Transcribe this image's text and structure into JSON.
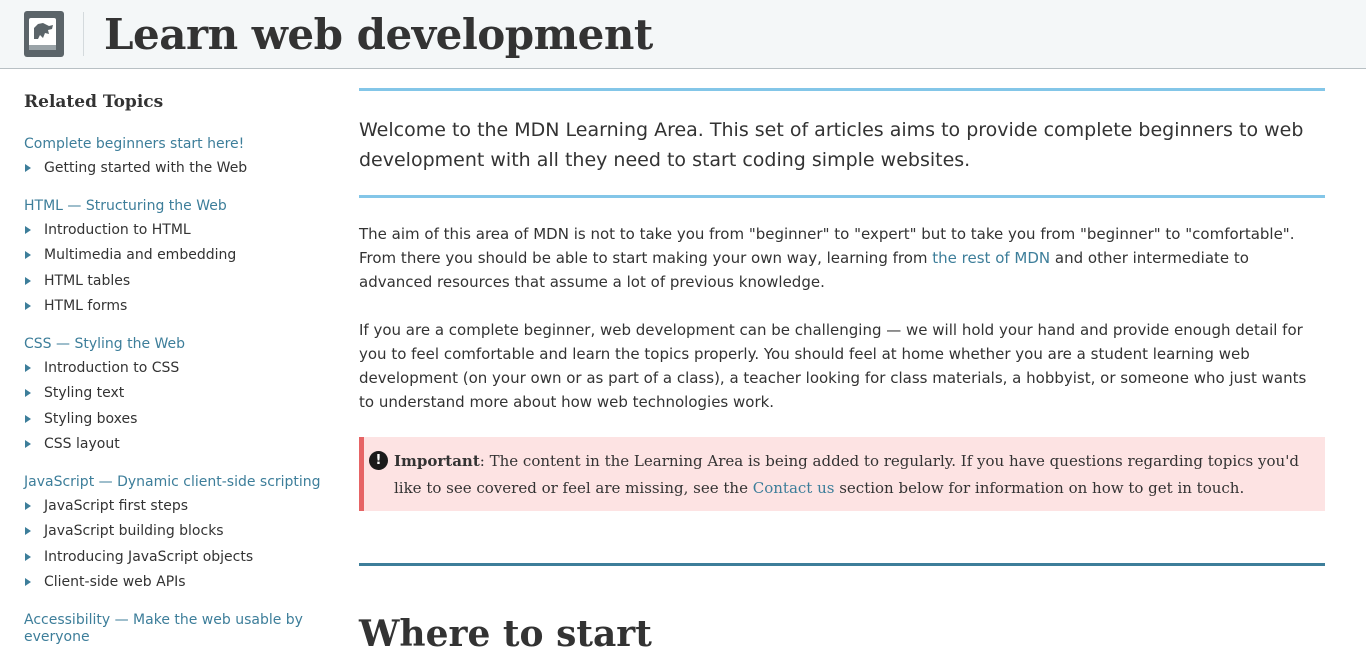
{
  "header": {
    "title": "Learn web development"
  },
  "sidebar": {
    "heading": "Related Topics",
    "groups": [
      {
        "title": "Complete beginners start here!",
        "items": [
          "Getting started with the Web"
        ]
      },
      {
        "title": "HTML — Structuring the Web",
        "items": [
          "Introduction to HTML",
          "Multimedia and embedding",
          "HTML tables",
          "HTML forms"
        ]
      },
      {
        "title": "CSS — Styling the Web",
        "items": [
          "Introduction to CSS",
          "Styling text",
          "Styling boxes",
          "CSS layout"
        ]
      },
      {
        "title": "JavaScript — Dynamic client-side scripting",
        "items": [
          "JavaScript first steps",
          "JavaScript building blocks",
          "Introducing JavaScript objects",
          "Client-side web APIs"
        ]
      },
      {
        "title": "Accessibility — Make the web usable by everyone",
        "items": []
      }
    ]
  },
  "main": {
    "intro": "Welcome to the MDN Learning Area. This set of articles aims to provide complete beginners to web development with all they need to start coding simple websites.",
    "para1_before": "The aim of this area of MDN is not to take you from \"beginner\" to \"expert\" but to take you from \"beginner\" to \"comfortable\". From there you should be able to start making your own way, learning from ",
    "para1_link": "the rest of MDN",
    "para1_after": " and other intermediate to advanced resources that assume a lot of previous knowledge.",
    "para2": "If you are a complete beginner, web development can be challenging — we will hold your hand and provide enough detail for you to feel comfortable and learn the topics properly. You should feel at home whether you are a student learning web development (on your own or as part of a class), a teacher looking for class materials, a hobbyist, or someone who just wants to understand more about how web technologies work.",
    "note": {
      "icon": "exclamation-icon",
      "label": "Important",
      "text_before": ": The content in the Learning Area is being added to regularly. If you have questions regarding topics you'd like to see covered or feel are missing, see the ",
      "link": "Contact us",
      "text_after": " section below for information on how to get in touch."
    },
    "section_title": "Where to start"
  },
  "colors": {
    "link": "#3d7e9a",
    "rule_light": "#83c6e8",
    "rule_dark": "#3d7e9a",
    "note_bg": "#fde3e3",
    "note_border": "#e66465",
    "header_bg": "#f4f7f8"
  }
}
